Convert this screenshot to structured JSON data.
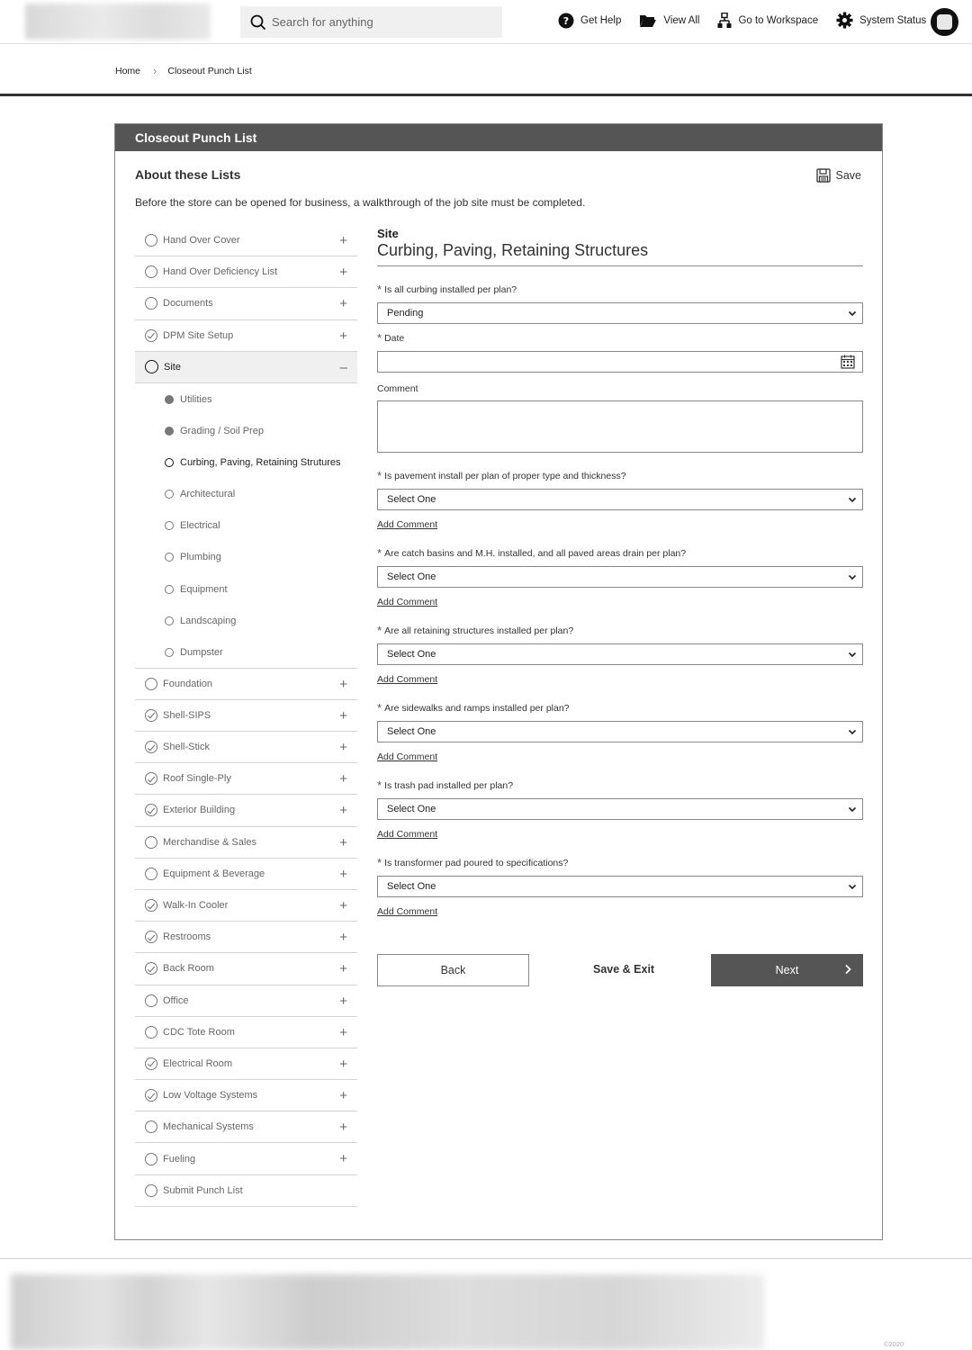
{
  "header": {
    "search_placeholder": "Search for anything",
    "links": [
      {
        "label": "Get Help",
        "icon": "help-icon"
      },
      {
        "label": "View All",
        "icon": "folder-icon"
      },
      {
        "label": "Go to Workspace",
        "icon": "workspace-icon"
      },
      {
        "label": "System Status",
        "icon": "gear-icon"
      }
    ]
  },
  "breadcrumb": {
    "home": "Home",
    "current": "Closeout Punch List"
  },
  "card": {
    "title": "Closeout Punch List",
    "about": "About these Lists",
    "save": "Save",
    "description": "Before the store can be opened for business, a walkthrough of the job site must be completed."
  },
  "sidebar": {
    "items_top": [
      {
        "label": "Hand Over Cover",
        "status": "open"
      },
      {
        "label": "Hand Over Deficiency List",
        "status": "open"
      },
      {
        "label": "Documents",
        "status": "open"
      },
      {
        "label": "DPM Site Setup",
        "status": "checked"
      }
    ],
    "active": {
      "label": "Site"
    },
    "subitems": [
      {
        "label": "Utilities",
        "status": "filled"
      },
      {
        "label": "Grading / Soil Prep",
        "status": "filled"
      },
      {
        "label": "Curbing, Paving, Retaining Strutures",
        "status": "current"
      },
      {
        "label": "Architectural",
        "status": "open"
      },
      {
        "label": "Electrical",
        "status": "open"
      },
      {
        "label": "Plumbing",
        "status": "open"
      },
      {
        "label": "Equipment",
        "status": "open"
      },
      {
        "label": "Landscaping",
        "status": "open"
      },
      {
        "label": "Dumpster",
        "status": "open"
      }
    ],
    "items_bottom": [
      {
        "label": "Foundation",
        "status": "open"
      },
      {
        "label": "Shell-SIPS",
        "status": "checked"
      },
      {
        "label": "Shell-Stick",
        "status": "checked"
      },
      {
        "label": "Roof Single-Ply",
        "status": "checked"
      },
      {
        "label": "Exterior Building",
        "status": "checked"
      },
      {
        "label": "Merchandise & Sales",
        "status": "open"
      },
      {
        "label": "Equipment & Beverage",
        "status": "open"
      },
      {
        "label": "Walk-In Cooler",
        "status": "checked"
      },
      {
        "label": "Restrooms",
        "status": "checked"
      },
      {
        "label": "Back Room",
        "status": "checked"
      },
      {
        "label": "Office",
        "status": "open"
      },
      {
        "label": "CDC Tote Room",
        "status": "open"
      },
      {
        "label": "Electrical Room",
        "status": "checked"
      },
      {
        "label": "Low Voltage Systems",
        "status": "checked"
      },
      {
        "label": "Mechanical Systems",
        "status": "open"
      },
      {
        "label": "Fueling",
        "status": "open"
      },
      {
        "label": "Submit Punch List",
        "status": "open"
      }
    ]
  },
  "form": {
    "section_label": "Site",
    "section_title": "Curbing, Paving, Retaining Structures",
    "q1": {
      "label": "Is all curbing installed per plan?",
      "value": "Pending"
    },
    "date_label": "Date",
    "comment_label": "Comment",
    "add_comment": "Add Comment",
    "questions": [
      {
        "label": "Is pavement install per plan of proper type and thickness?",
        "value": "Select One"
      },
      {
        "label": "Are catch basins and M.H. installed, and all paved areas drain per plan?",
        "value": "Select One"
      },
      {
        "label": "Are all retaining structures installed per plan?",
        "value": "Select One"
      },
      {
        "label": "Are sidewalks and ramps installed per plan?",
        "value": "Select One"
      },
      {
        "label": "Is trash pad installed per plan?",
        "value": "Select One"
      },
      {
        "label": "Is transformer pad poured to specifications?",
        "value": "Select One"
      }
    ],
    "back": "Back",
    "save_exit": "Save & Exit",
    "next": "Next"
  },
  "footer": {
    "copyright": "©2020"
  }
}
